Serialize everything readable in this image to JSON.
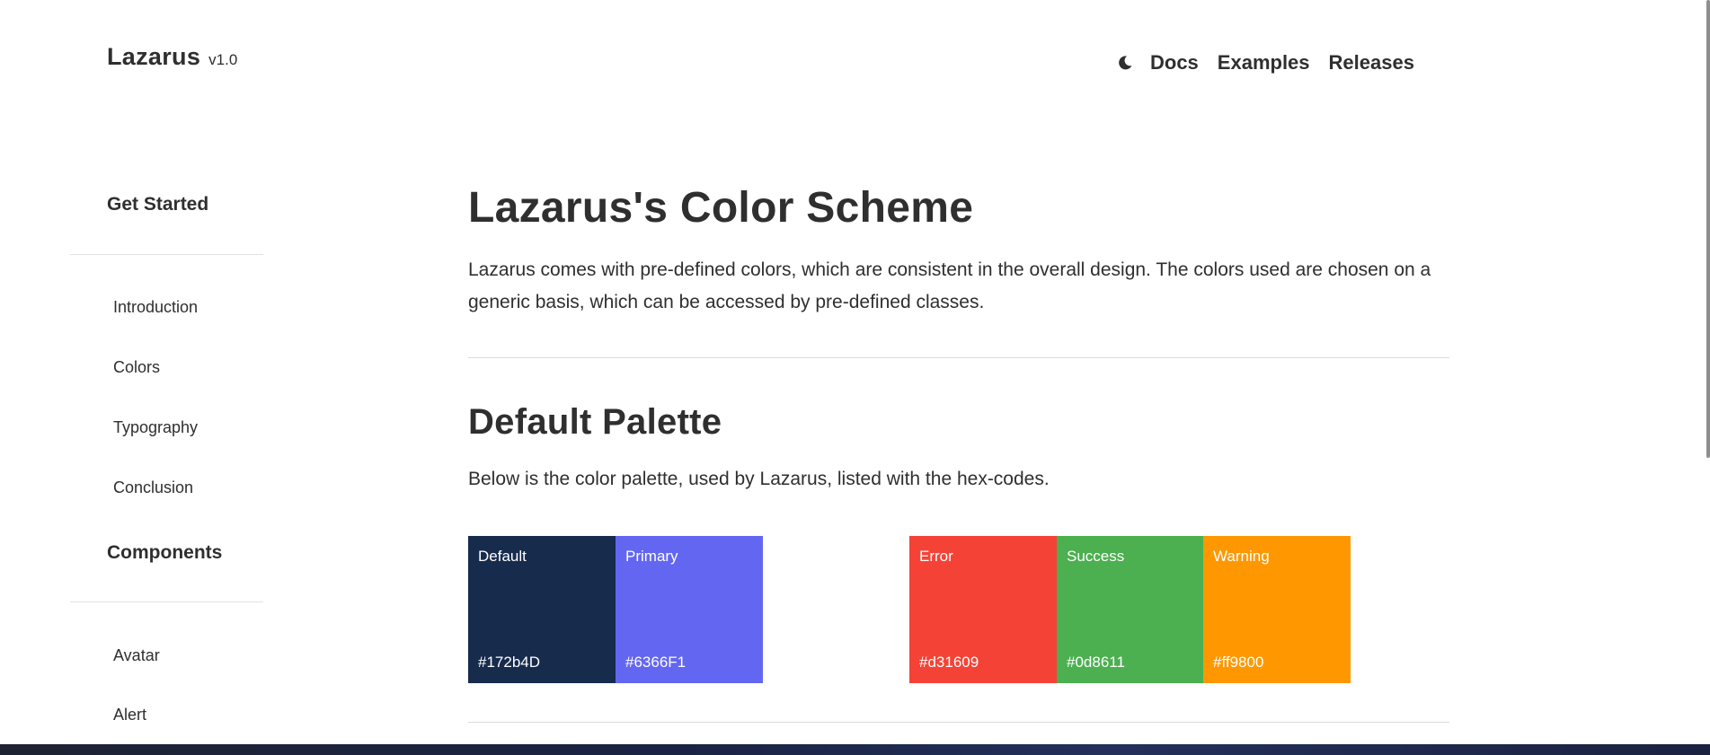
{
  "header": {
    "brand_name": "Lazarus",
    "brand_version": "v1.0",
    "theme_icon": "moon-icon",
    "nav": [
      "Docs",
      "Examples",
      "Releases"
    ]
  },
  "sidebar": {
    "sections": [
      {
        "heading": "Get Started",
        "items": [
          "Introduction",
          "Colors",
          "Typography",
          "Conclusion"
        ]
      },
      {
        "heading": "Components",
        "items": [
          "Avatar",
          "Alert"
        ]
      }
    ]
  },
  "main": {
    "title": "Lazarus's Color Scheme",
    "intro": "Lazarus comes with pre-defined colors, which are consistent in the overall design. The colors used are chosen on a generic basis, which can be accessed by pre-defined classes.",
    "palette_title": "Default Palette",
    "palette_intro": "Below is the color palette, used by Lazarus, listed with the hex-codes.",
    "swatches": [
      {
        "name": "Default",
        "hex": "#172b4D",
        "color": "#172b4d"
      },
      {
        "name": "Primary",
        "hex": "#6366F1",
        "color": "#6366f1"
      },
      {
        "name": "Error",
        "hex": "#d31609",
        "color": "#f44336"
      },
      {
        "name": "Success",
        "hex": "#0d8611",
        "color": "#4caf50"
      },
      {
        "name": "Warning",
        "hex": "#ff9800",
        "color": "#ff9800"
      }
    ]
  }
}
